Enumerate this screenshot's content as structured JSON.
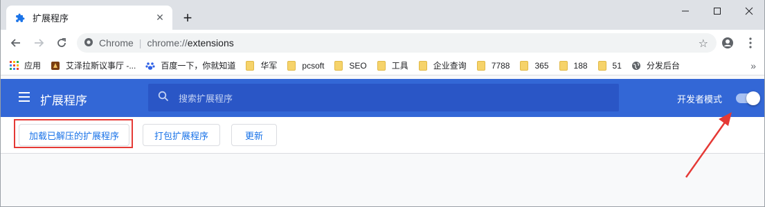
{
  "tab": {
    "title": "扩展程序",
    "close_glyph": "✕",
    "favicon": "puzzle-icon"
  },
  "new_tab_glyph": "+",
  "window_controls": {
    "minimize": "—",
    "maximize": "☐",
    "close": "✕"
  },
  "toolbar": {
    "back": "←",
    "forward": "→",
    "reload": "↻",
    "site_label": "Chrome",
    "separator": "|",
    "url_prefix": "chrome://",
    "url_path": "extensions",
    "star": "☆"
  },
  "bookmarks": [
    {
      "label": "应用",
      "icon": "apps-grid-icon"
    },
    {
      "label": "艾泽拉斯议事厅 -...",
      "icon": "bookmark-favicon-icon"
    },
    {
      "label": "百度一下，你就知道",
      "icon": "baidu-paw-icon"
    },
    {
      "label": "华军",
      "icon": "folder-icon"
    },
    {
      "label": "pcsoft",
      "icon": "folder-icon"
    },
    {
      "label": "SEO",
      "icon": "folder-icon"
    },
    {
      "label": "工具",
      "icon": "folder-icon"
    },
    {
      "label": "企业查询",
      "icon": "folder-icon"
    },
    {
      "label": "7788",
      "icon": "folder-icon"
    },
    {
      "label": "365",
      "icon": "folder-icon"
    },
    {
      "label": "188",
      "icon": "folder-icon"
    },
    {
      "label": "51",
      "icon": "folder-icon"
    },
    {
      "label": "分发后台",
      "icon": "globe-icon"
    }
  ],
  "bookmarks_more": "»",
  "extensions": {
    "title": "扩展程序",
    "search_placeholder": "搜索扩展程序",
    "dev_mode_label": "开发者模式",
    "dev_mode_on": true,
    "actions": {
      "load_unpacked": "加载已解压的扩展程序",
      "pack": "打包扩展程序",
      "update": "更新"
    }
  },
  "colors": {
    "header_blue": "#3367d6",
    "search_blue": "#2a56c6",
    "link_blue": "#1a73e8",
    "annotation_red": "#e53935"
  }
}
